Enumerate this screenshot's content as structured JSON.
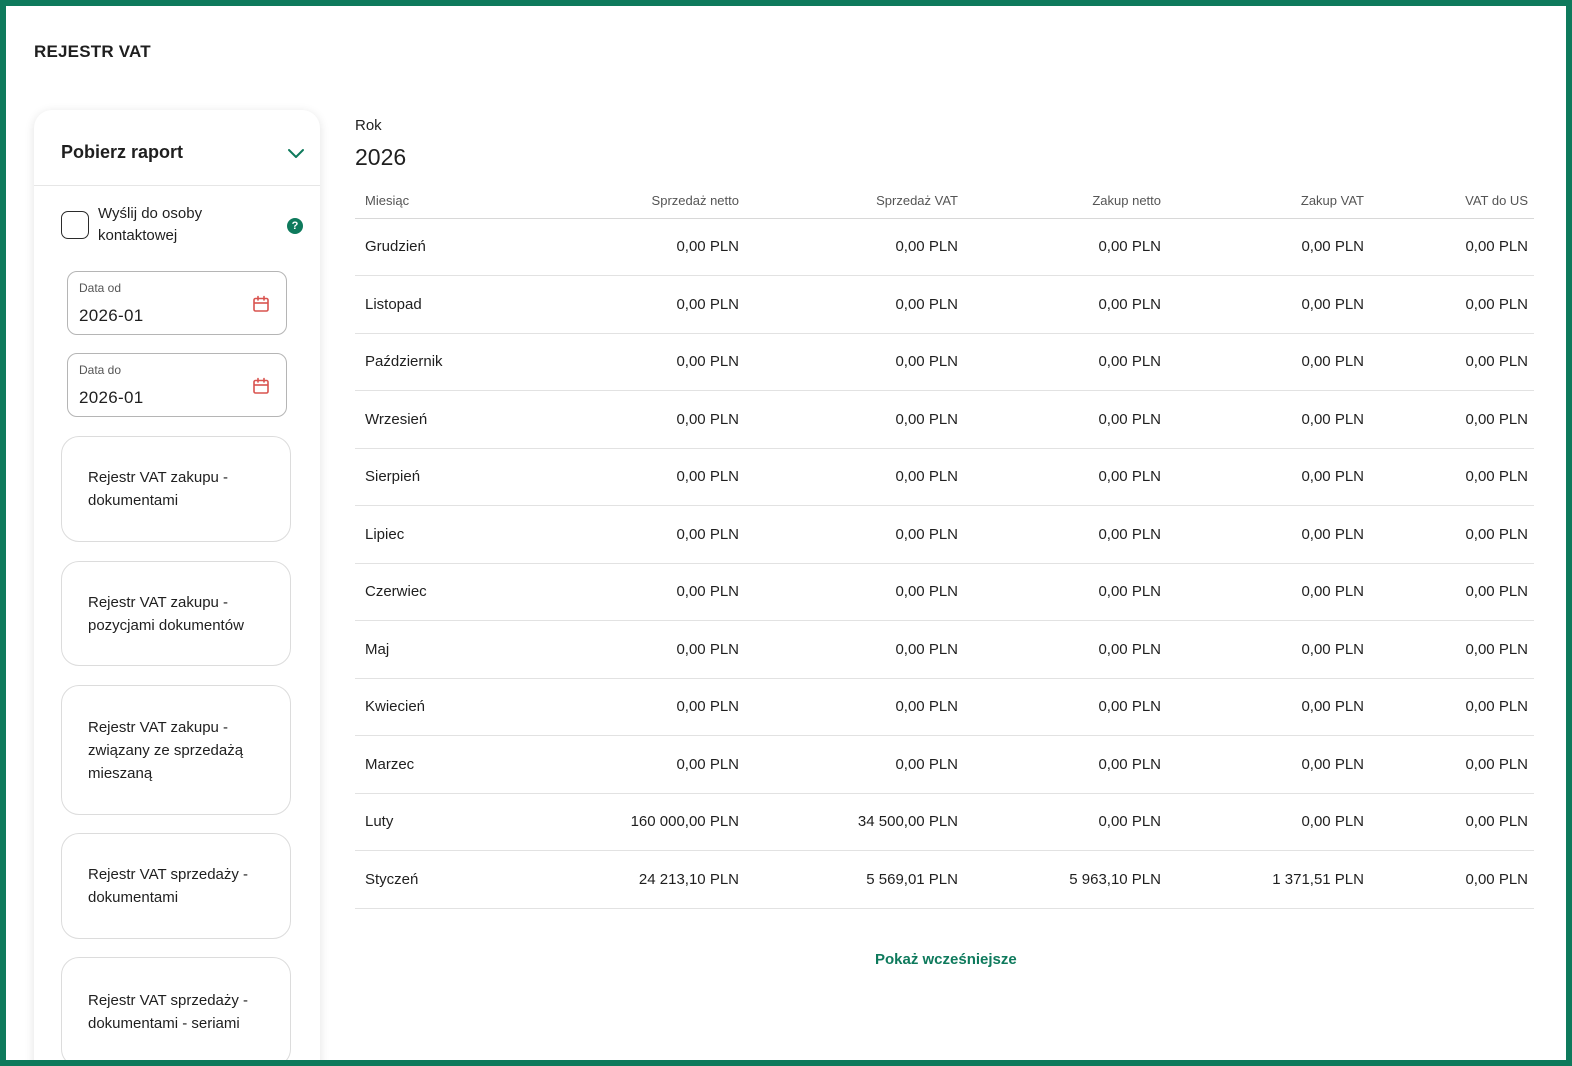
{
  "page": {
    "title": "REJESTR VAT"
  },
  "sidebar": {
    "header": "Pobierz raport",
    "send_checkbox_label": "Wyślij do osoby kontaktowej",
    "help_icon_glyph": "?",
    "date_from": {
      "label": "Data od",
      "value": "2026-01"
    },
    "date_to": {
      "label": "Data do",
      "value": "2026-01"
    },
    "reports": [
      "Rejestr VAT zakupu - dokumentami",
      "Rejestr VAT zakupu - pozycjami dokumentów",
      "Rejestr VAT zakupu - związany ze sprzedażą mieszaną",
      "Rejestr VAT sprzedaży - dokumentami",
      "Rejestr VAT sprzedaży - dokumentami - seriami"
    ]
  },
  "main": {
    "year_label": "Rok",
    "year_value": "2026",
    "columns": [
      "Miesiąc",
      "Sprzedaż netto",
      "Sprzedaż VAT",
      "Zakup netto",
      "Zakup VAT",
      "VAT do US"
    ],
    "rows": [
      [
        "Grudzień",
        "0,00 PLN",
        "0,00 PLN",
        "0,00 PLN",
        "0,00 PLN",
        "0,00 PLN"
      ],
      [
        "Listopad",
        "0,00 PLN",
        "0,00 PLN",
        "0,00 PLN",
        "0,00 PLN",
        "0,00 PLN"
      ],
      [
        "Październik",
        "0,00 PLN",
        "0,00 PLN",
        "0,00 PLN",
        "0,00 PLN",
        "0,00 PLN"
      ],
      [
        "Wrzesień",
        "0,00 PLN",
        "0,00 PLN",
        "0,00 PLN",
        "0,00 PLN",
        "0,00 PLN"
      ],
      [
        "Sierpień",
        "0,00 PLN",
        "0,00 PLN",
        "0,00 PLN",
        "0,00 PLN",
        "0,00 PLN"
      ],
      [
        "Lipiec",
        "0,00 PLN",
        "0,00 PLN",
        "0,00 PLN",
        "0,00 PLN",
        "0,00 PLN"
      ],
      [
        "Czerwiec",
        "0,00 PLN",
        "0,00 PLN",
        "0,00 PLN",
        "0,00 PLN",
        "0,00 PLN"
      ],
      [
        "Maj",
        "0,00 PLN",
        "0,00 PLN",
        "0,00 PLN",
        "0,00 PLN",
        "0,00 PLN"
      ],
      [
        "Kwiecień",
        "0,00 PLN",
        "0,00 PLN",
        "0,00 PLN",
        "0,00 PLN",
        "0,00 PLN"
      ],
      [
        "Marzec",
        "0,00 PLN",
        "0,00 PLN",
        "0,00 PLN",
        "0,00 PLN",
        "0,00 PLN"
      ],
      [
        "Luty",
        "160 000,00 PLN",
        "34 500,00 PLN",
        "0,00 PLN",
        "0,00 PLN",
        "0,00 PLN"
      ],
      [
        "Styczeń",
        "24 213,10 PLN",
        "5 569,01 PLN",
        "5 963,10 PLN",
        "1 371,51 PLN",
        "0,00 PLN"
      ]
    ],
    "show_more_label": "Pokaż wcześniejsze"
  },
  "colors": {
    "accent": "#0e7a5c",
    "calendar_icon": "#d9534f"
  },
  "icons": {
    "chevron": "chevron-down-icon",
    "help": "help-icon",
    "calendar": "calendar-icon"
  }
}
